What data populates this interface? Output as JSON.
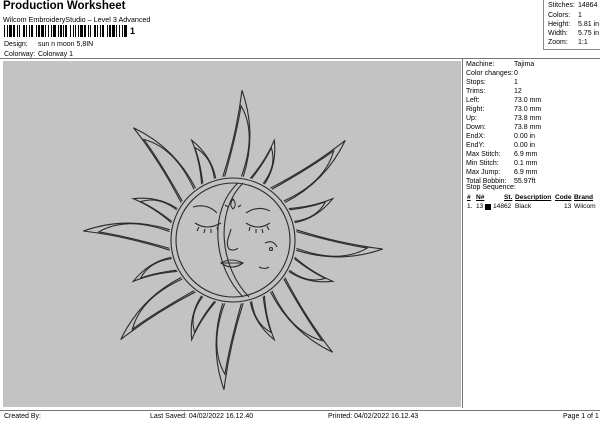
{
  "header": {
    "title": "Production Worksheet",
    "subtitle": "Wilcom EmbroideryStudio – Level 3 Advanced",
    "barcode_number": "1"
  },
  "design": {
    "label": "Design:",
    "value": "sun n moon 5,8IN"
  },
  "colorway": {
    "label": "Colorway:",
    "value": "Colorway 1"
  },
  "stats": [
    {
      "label": "Stitches:",
      "value": "14864"
    },
    {
      "label": "Colors:",
      "value": "1"
    },
    {
      "label": "Height:",
      "value": "5.81 in"
    },
    {
      "label": "Width:",
      "value": "5.75 in"
    },
    {
      "label": "Zoom:",
      "value": "1:1"
    }
  ],
  "machine_info": [
    {
      "label": "Machine:",
      "value": "Tajima"
    },
    {
      "label": "Color changes:",
      "value": "0"
    },
    {
      "label": "Stops:",
      "value": "1"
    },
    {
      "label": "Trims:",
      "value": "12"
    },
    {
      "label": "Left:",
      "value": "73.0 mm"
    },
    {
      "label": "Right:",
      "value": "73.0 mm"
    },
    {
      "label": "Up:",
      "value": "73.8 mm"
    },
    {
      "label": "Down:",
      "value": "73.8 mm"
    },
    {
      "label": "EndX:",
      "value": "0.00 in"
    },
    {
      "label": "EndY:",
      "value": "0.00 in"
    },
    {
      "label": "Max Stitch:",
      "value": "6.9 mm"
    },
    {
      "label": "Min Stitch:",
      "value": "0.1 mm"
    },
    {
      "label": "Max Jump:",
      "value": "6.9 mm"
    },
    {
      "label": "Total Bobbin:",
      "value": "55.97ft"
    }
  ],
  "stop_sequence": {
    "label": "Stop Sequence:",
    "headers": [
      "#",
      "N#",
      "St.",
      "Description",
      "Code",
      "Brand"
    ],
    "rows": [
      {
        "num": "1.",
        "needle": "13",
        "stitches": "14862",
        "description": "Black",
        "code": "13",
        "brand": "Wilcom",
        "color": "#000000"
      }
    ]
  },
  "footer": {
    "created_by": "Created By:",
    "last_saved": "Last Saved: 04/02/2022 16.12.40",
    "printed": "Printed: 04/02/2022 16.12.43",
    "page": "Page 1 of 1"
  },
  "colors": {
    "canvas": "#c3c3c3",
    "thread": "#2b2b2b"
  }
}
